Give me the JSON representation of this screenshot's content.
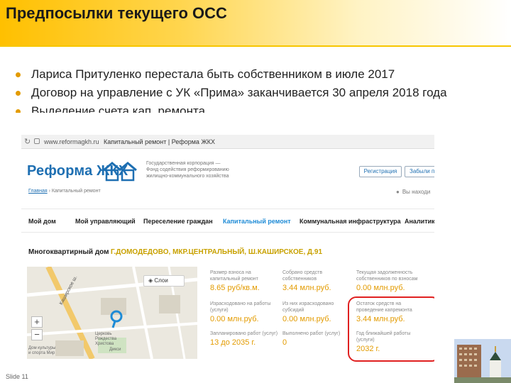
{
  "slide": {
    "title": "Предпосылки текущего ОСС",
    "bullets": [
      "Лариса Притуленко перестала быть собственником в июле 2017",
      "Договор на управление с УК «Прима» заканчивается 30 апреля 2018 года",
      "Выделение счета кап. ремонта"
    ],
    "footer": "Slide 11"
  },
  "browser": {
    "url": "www.reformagkh.ru",
    "page_title": "Капитальный ремонт | Реформа ЖКХ"
  },
  "site": {
    "logo_text": "Реформа ЖКХ",
    "org_line1": "Государственная корпорация —",
    "org_line2": "Фонд содействия реформированию",
    "org_line3": "жилищно-коммунального хозяйства",
    "register_btn": "Регистрация",
    "forgot_btn": "Забыли па",
    "breadcrumb_home": "Главная",
    "breadcrumb_sep": "›",
    "breadcrumb_current": "Капитальный ремонт",
    "location_text": "Вы находи",
    "nav": [
      "Мой дом",
      "Мой управляющий",
      "Переселение граждан",
      "Капитальный ремонт",
      "Коммунальная инфраструктура",
      "Аналитика"
    ],
    "house_label": "Многоквартирный дом",
    "house_address": "Г.ДОМОДЕДОВО, МКР.ЦЕНТРАЛЬНЫЙ, Ш.КАШИРСКОЕ, Д.91"
  },
  "map": {
    "layers_label": "Слои",
    "zoom_in": "+",
    "zoom_out": "−",
    "street_label": "Каширское ш.",
    "labels": [
      "Церковь",
      "Рождества",
      "Христова",
      "Дом культуры",
      "и спорта Мир",
      "Дикси"
    ]
  },
  "stats": [
    {
      "label": "Размер взноса на капитальный ремонт",
      "value": "8.65 руб/кв.м."
    },
    {
      "label": "Собрано средств собственников",
      "value": "3.44 млн.руб."
    },
    {
      "label": "Текущая задолженность собственников по взносам",
      "value": "0.00 млн.руб."
    },
    {
      "label": "Израсходовано на работы (услуги)",
      "value": "0.00 млн.руб."
    },
    {
      "label": "Из них израсходовано субсидий",
      "value": "0.00 млн.руб."
    },
    {
      "label": "Остаток средств на проведение капремонта",
      "value": "3.44 млн.руб."
    },
    {
      "label": "Запланировано работ (услуг)",
      "value": "13 до 2035 г."
    },
    {
      "label": "Выполнено работ (услуг)",
      "value": "0"
    },
    {
      "label": "Год ближайшей работы (услуги)",
      "value": "2032 г."
    }
  ],
  "colors": {
    "title_bar": "#ffc000",
    "bullet": "#e39b00",
    "link": "#1e6fb2",
    "active_nav": "#1e8bd6",
    "stat_value": "#e39b00",
    "highlight": "#e02020"
  },
  "icons": [
    "reload-icon",
    "lock-icon",
    "houses-logo-icon",
    "location-pin-icon",
    "map-pin-icon",
    "layers-icon"
  ]
}
